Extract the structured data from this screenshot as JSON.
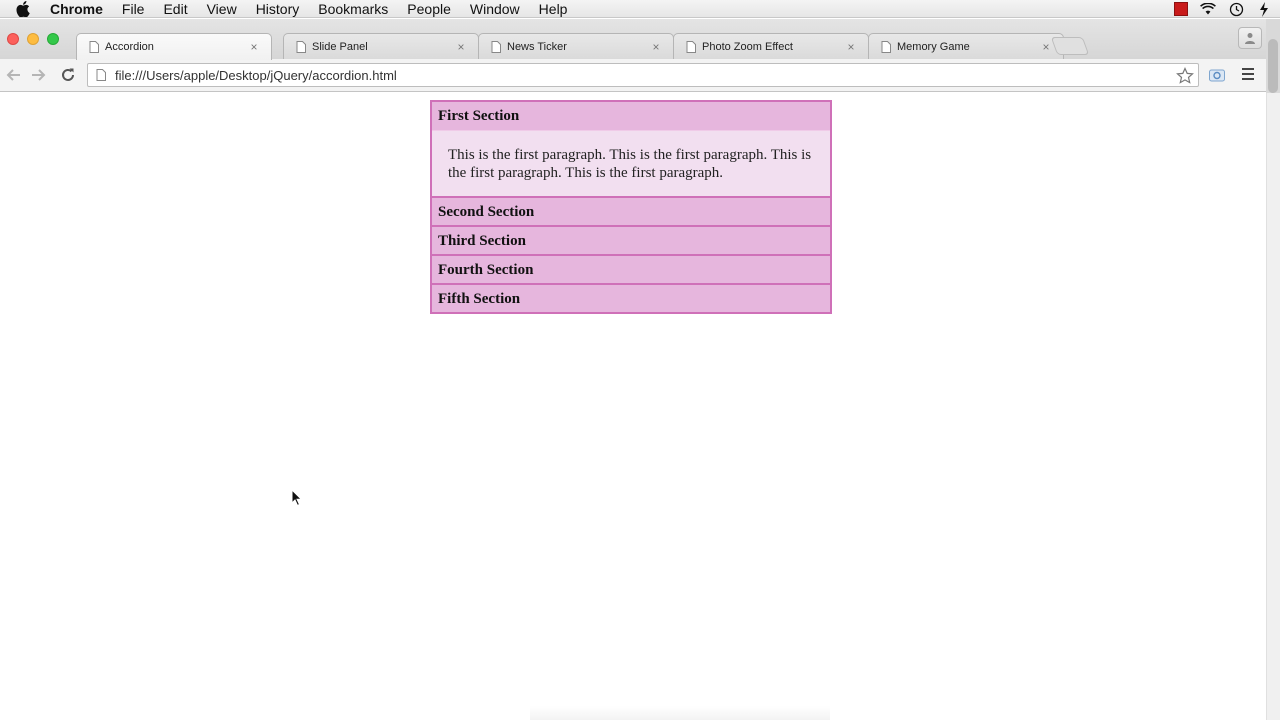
{
  "menubar": {
    "app_name": "Chrome",
    "items": [
      "File",
      "Edit",
      "View",
      "History",
      "Bookmarks",
      "People",
      "Window",
      "Help"
    ]
  },
  "tabs": [
    {
      "label": "Accordion",
      "active": true
    },
    {
      "label": "Slide Panel",
      "active": false
    },
    {
      "label": "News Ticker",
      "active": false
    },
    {
      "label": "Photo Zoom Effect",
      "active": false
    },
    {
      "label": "Memory Game",
      "active": false
    }
  ],
  "tab_close_glyph": "×",
  "address_bar": {
    "url": "file:///Users/apple/Desktop/jQuery/accordion.html"
  },
  "accordion": {
    "sections": [
      {
        "title": "First Section",
        "expanded": true,
        "content": "This is the first paragraph. This is the first paragraph. This is the first paragraph. This is the first paragraph."
      },
      {
        "title": "Second Section",
        "expanded": false
      },
      {
        "title": "Third Section",
        "expanded": false
      },
      {
        "title": "Fourth Section",
        "expanded": false
      },
      {
        "title": "Fifth Section",
        "expanded": false
      }
    ]
  },
  "icons": {
    "apple": "apple-icon",
    "wifi": "wifi-icon",
    "time_machine": "time-machine-icon",
    "battery": "battery-icon",
    "back": "back-arrow-icon",
    "forward": "forward-arrow-icon",
    "reload": "reload-icon",
    "star": "star-icon",
    "menu": "hamburger-menu-icon"
  },
  "colors": {
    "accordion_border": "#cf70b8",
    "accordion_header_bg": "#e6b6dd",
    "accordion_panel_bg": "#f2dff0"
  }
}
